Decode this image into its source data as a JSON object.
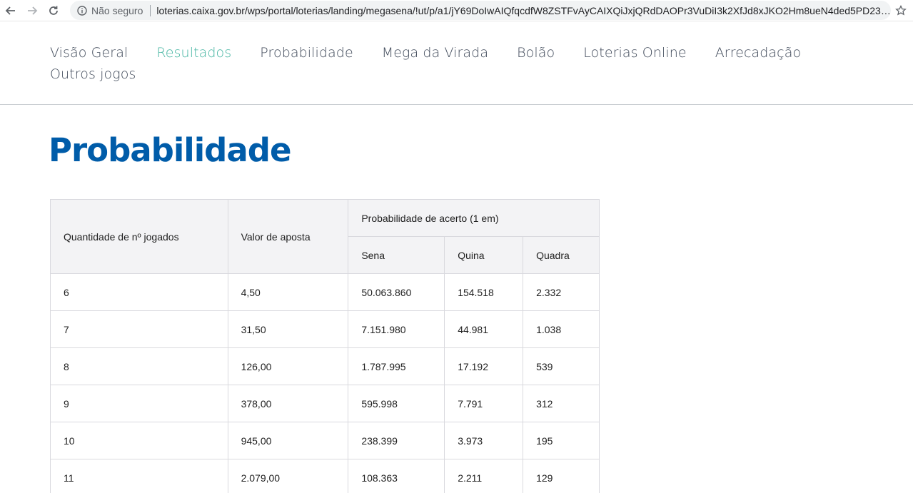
{
  "browser": {
    "security_label": "Não seguro",
    "url": "loterias.caixa.gov.br/wps/portal/loterias/landing/megasena/!ut/p/a1/jY69DoIwAIQfqcdfW8ZSTFvAyCAIXQiJxjQRdDAOPr3VuDiI3k2XfJd8xJKO2Hm8ueN4ded5PD23p..."
  },
  "site_nav": {
    "items": [
      {
        "label": "Visão Geral"
      },
      {
        "label": "Resultados"
      },
      {
        "label": "Probabilidade"
      },
      {
        "label": "Mega da Virada"
      },
      {
        "label": "Bolão"
      },
      {
        "label": "Loterias Online"
      },
      {
        "label": "Arrecadação"
      },
      {
        "label": "Outros jogos"
      }
    ],
    "active_color": "#46b5a2"
  },
  "page": {
    "title": "Probabilidade",
    "title_color": "#005ca9"
  },
  "table": {
    "headers": {
      "quantidade": "Quantidade de nº jogados",
      "valor": "Valor de aposta",
      "probabilidade": "Probabilidade de acerto (1 em)",
      "sena": "Sena",
      "quina": "Quina",
      "quadra": "Quadra"
    },
    "rows": [
      [
        "6",
        "4,50",
        "50.063.860",
        "154.518",
        "2.332"
      ],
      [
        "7",
        "31,50",
        "7.151.980",
        "44.981",
        "1.038"
      ],
      [
        "8",
        "126,00",
        "1.787.995",
        "17.192",
        "539"
      ],
      [
        "9",
        "378,00",
        "595.998",
        "7.791",
        "312"
      ],
      [
        "10",
        "945,00",
        "238.399",
        "3.973",
        "195"
      ],
      [
        "11",
        "2.079,00",
        "108.363",
        "2.211",
        "129"
      ]
    ]
  }
}
